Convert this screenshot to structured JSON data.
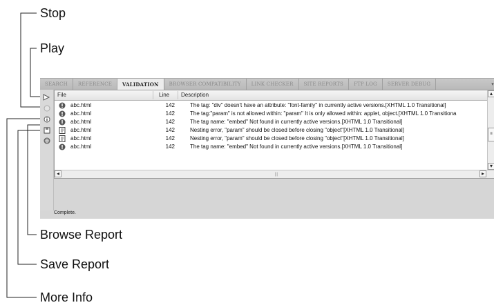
{
  "callouts": {
    "stop": "Stop",
    "play": "Play",
    "browse_report": "Browse Report",
    "save_report": "Save Report",
    "more_info": "More Info"
  },
  "tabs": [
    {
      "label": "SEARCH",
      "active": false
    },
    {
      "label": "REFERENCE",
      "active": false
    },
    {
      "label": "VALIDATION",
      "active": true
    },
    {
      "label": "BROWSER COMPATIBILITY",
      "active": false
    },
    {
      "label": "LINK CHECKER",
      "active": false
    },
    {
      "label": "SITE REPORTS",
      "active": false
    },
    {
      "label": "FTP LOG",
      "active": false
    },
    {
      "label": "SERVER DEBUG",
      "active": false
    }
  ],
  "tools": [
    "play-icon",
    "stop-icon",
    "more-info-icon",
    "save-report-icon",
    "browse-report-icon"
  ],
  "columns": {
    "file": "File",
    "line": "Line",
    "description": "Description"
  },
  "rows": [
    {
      "icon": "error-icon",
      "file": "abc.html",
      "line": "142",
      "description": "The tag: \"div\" doesn't have an attribute: \"font-family\" in currently active versions.[XHTML 1.0 Transitional]"
    },
    {
      "icon": "error-icon",
      "file": "abc.html",
      "line": "142",
      "description": "The tag:\"param\" is not allowed within: \"param\" It is only allowed within: applet, object.[XHTML 1.0 Transitiona"
    },
    {
      "icon": "error-icon",
      "file": "abc.html",
      "line": "142",
      "description": "The tag name: \"embed\" Not found in currently active versions.[XHTML 1.0 Transitional]"
    },
    {
      "icon": "warning-doc-icon",
      "file": "abc.html",
      "line": "142",
      "description": "Nesting error, \"param\" should be closed before closing \"object\"[XHTML 1.0 Transitional]"
    },
    {
      "icon": "warning-doc-icon",
      "file": "abc.html",
      "line": "142",
      "description": "Nesting error, \"param\" should be closed before closing \"object\"[XHTML 1.0 Transitional]"
    },
    {
      "icon": "error-icon",
      "file": "abc.html",
      "line": "142",
      "description": "The tag name: \"embed\" Not found in currently active versions.[XHTML 1.0 Transitional]"
    }
  ],
  "status": "Complete."
}
